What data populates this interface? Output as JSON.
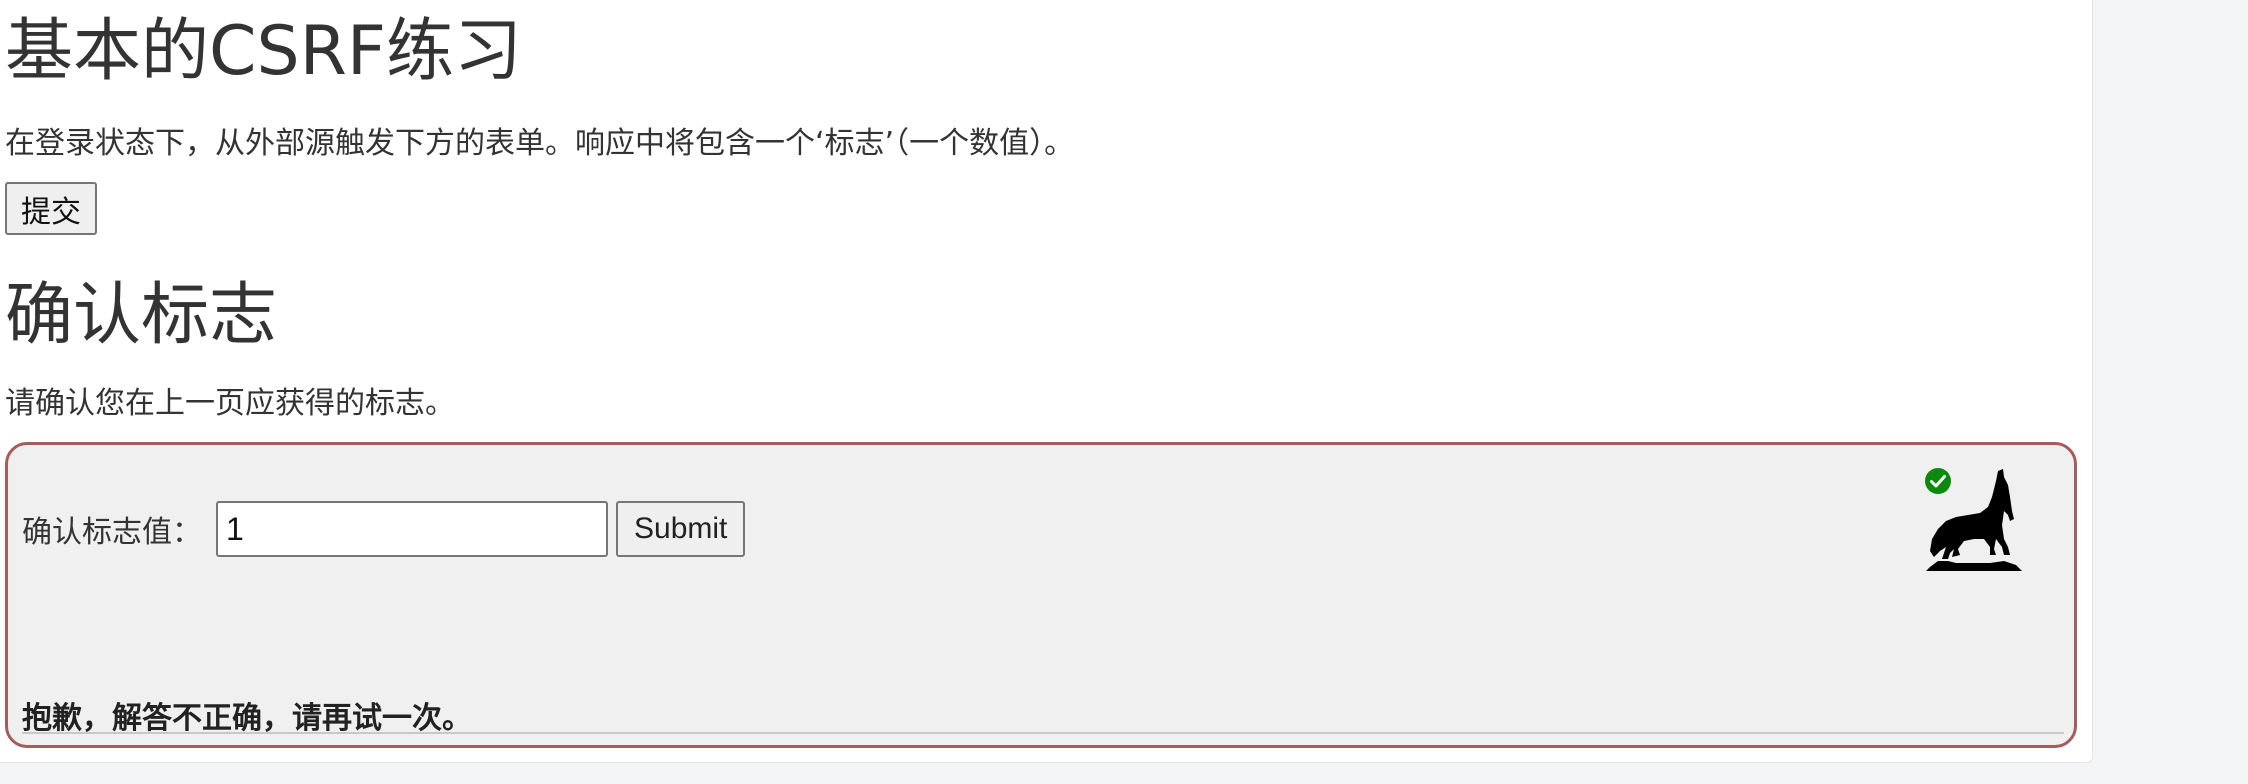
{
  "section1": {
    "title": "基本的CSRF练习",
    "description": "在登录状态下，从外部源触发下方的表单。响应中将包含一个‘标志’（一个数值）。",
    "submit_label": "提交"
  },
  "section2": {
    "title": "确认标志",
    "description": "请确认您在上一页应获得的标志。"
  },
  "flag_form": {
    "label": "确认标志值：",
    "input_value": "1",
    "submit_label": "Submit"
  },
  "result": {
    "message": "抱歉，解答不正确，请再试一次。"
  },
  "icons": {
    "status": "check-circle-icon",
    "mascot": "wolf-icon"
  },
  "colors": {
    "panel_border": "#a35d5d",
    "panel_bg": "#f0f0f0",
    "status_green": "#0a8a0a"
  }
}
